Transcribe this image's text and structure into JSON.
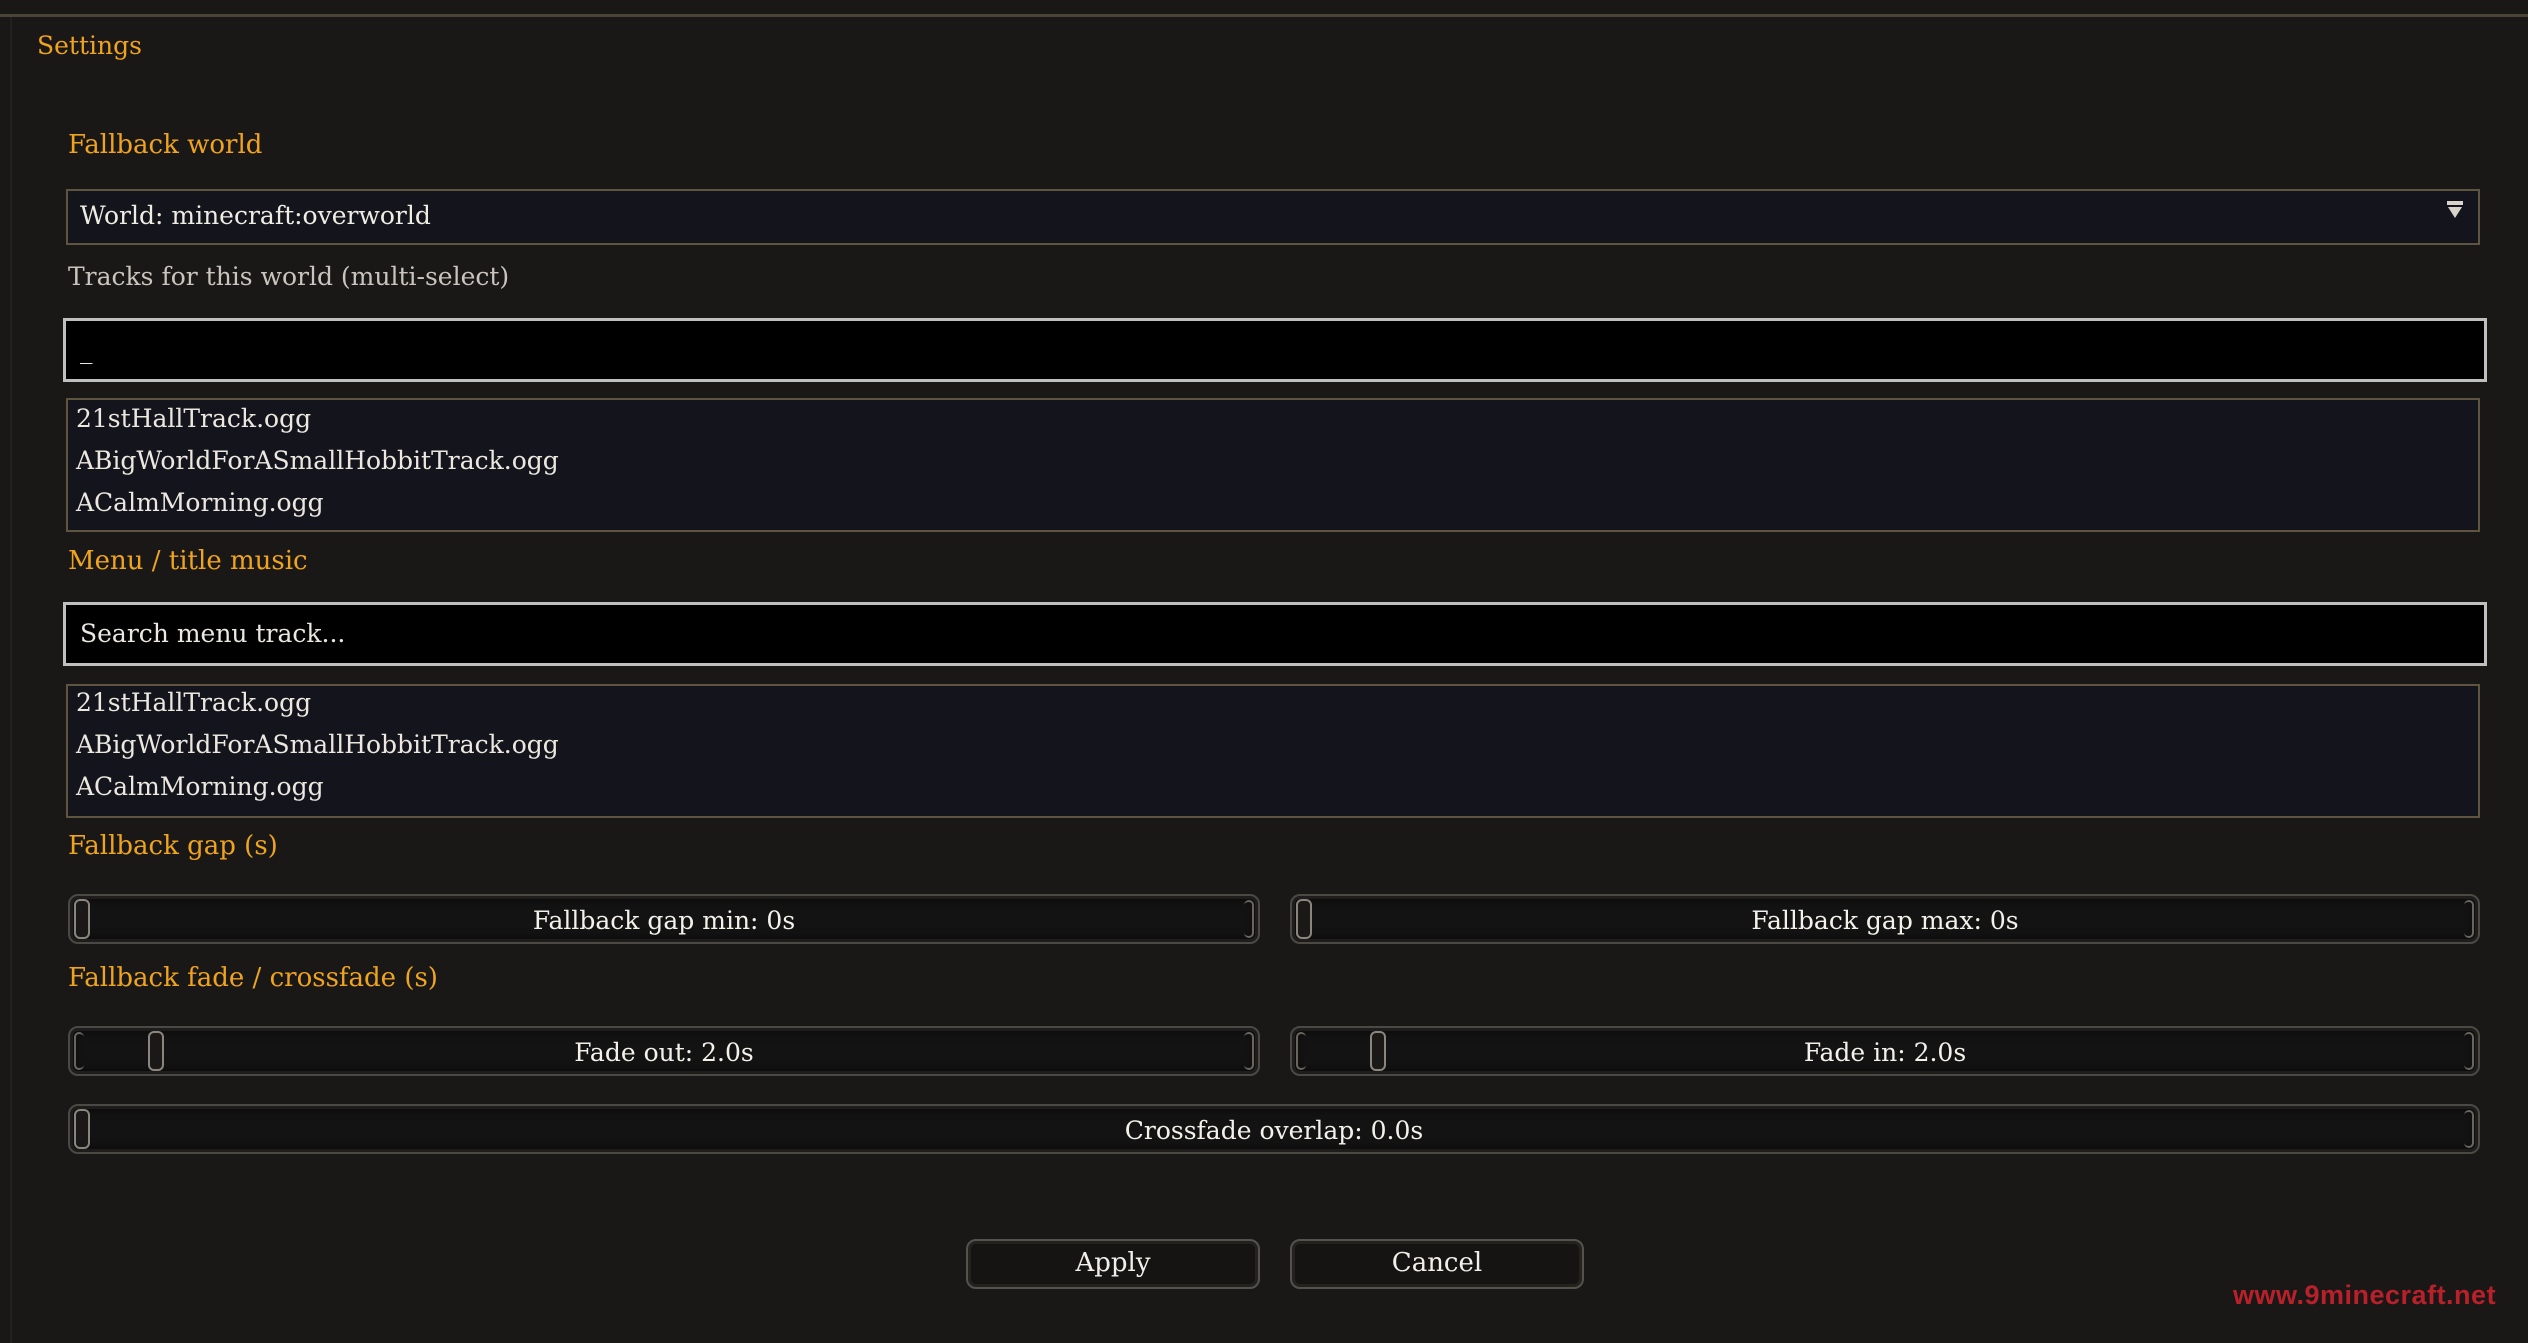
{
  "header": {
    "title": "Settings"
  },
  "fallback_world": {
    "label": "Fallback world",
    "world_select_value": "World: minecraft:overworld",
    "tracks_label": "Tracks for this world (multi-select)",
    "track_search_value": "_",
    "tracks": [
      "21stHallTrack.ogg",
      "ABigWorldForASmallHobbitTrack.ogg",
      "ACalmMorning.ogg"
    ]
  },
  "menu_music": {
    "label": "Menu / title music",
    "search_placeholder": "Search menu track...",
    "tracks": [
      "21stHallTrack.ogg",
      "ABigWorldForASmallHobbitTrack.ogg",
      "ACalmMorning.ogg"
    ]
  },
  "fallback_gap": {
    "label": "Fallback gap (s)",
    "min_label": "Fallback gap min: 0s",
    "min_value": 0,
    "max_label": "Fallback gap max: 0s",
    "max_value": 0
  },
  "fallback_fade": {
    "label": "Fallback fade / crossfade (s)",
    "fade_out_label": "Fade out: 2.0s",
    "fade_out_value": 2.0,
    "fade_in_label": "Fade in: 2.0s",
    "fade_in_value": 2.0,
    "crossfade_label": "Crossfade overlap: 0.0s",
    "crossfade_value": 0.0
  },
  "actions": {
    "apply_label": "Apply",
    "cancel_label": "Cancel"
  },
  "watermark": "www.9minecraft.net",
  "colors": {
    "accent": "#f0a41e",
    "background": "#191817",
    "watermark": "#b8202a"
  }
}
